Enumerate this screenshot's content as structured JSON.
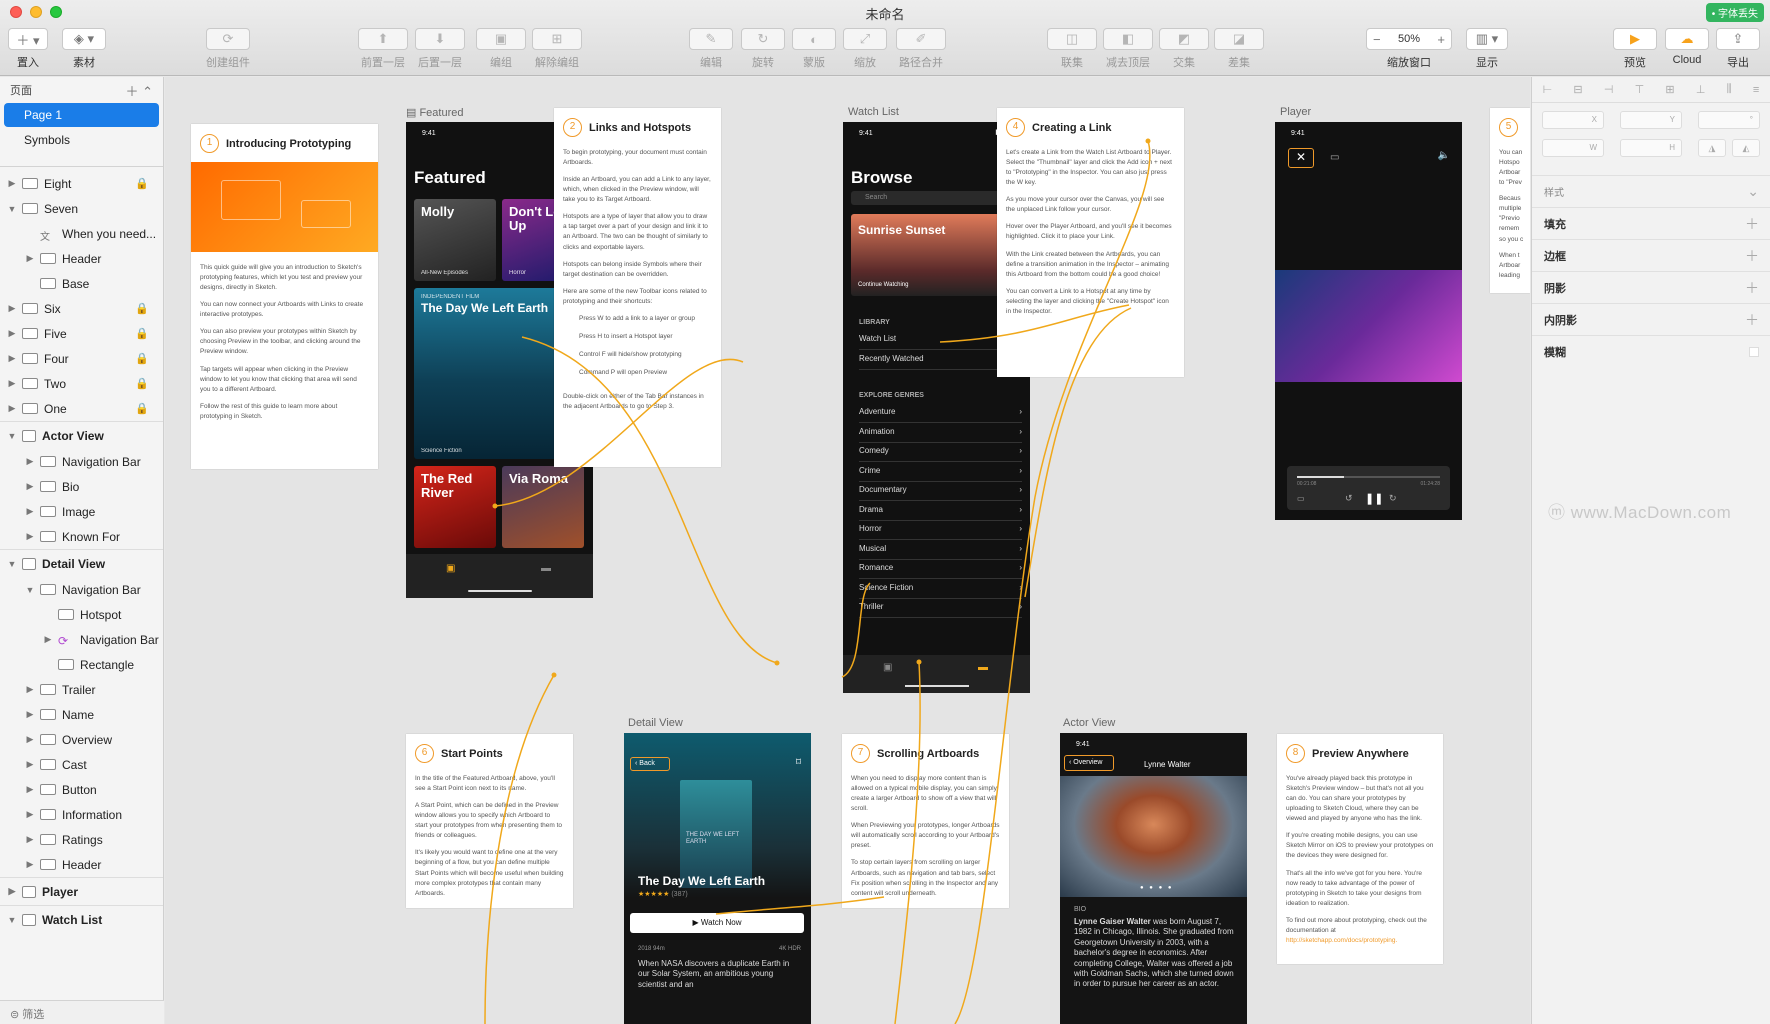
{
  "window": {
    "title": "未命名",
    "font_missing": "• 字体丢失"
  },
  "toolbar": {
    "insert": "置入",
    "assets": "素材",
    "create_symbol": "创建组件",
    "forward": "前置一层",
    "backward": "后置一层",
    "group": "编组",
    "ungroup": "解除编组",
    "edit": "编辑",
    "rotate": "旋转",
    "mask": "蒙版",
    "scale": "缩放",
    "flatten": "路径合并",
    "union": "联集",
    "subtract": "减去顶层",
    "intersect": "交集",
    "difference": "差集",
    "zoom_value": "50%",
    "zoom_label": "缩放窗口",
    "view": "显示",
    "preview": "预览",
    "cloud": "Cloud",
    "export": "导出"
  },
  "sidebar": {
    "pages_header": "页面",
    "pages": [
      "Page 1",
      "Symbols"
    ],
    "layers": [
      {
        "label": "Eight",
        "indent": 0,
        "arrow": "▶",
        "lock": true
      },
      {
        "label": "Seven",
        "indent": 0,
        "arrow": "▼",
        "lock": false
      },
      {
        "label": "When you need...",
        "indent": 1,
        "arrow": "",
        "lock": false,
        "text": true
      },
      {
        "label": "Header",
        "indent": 1,
        "arrow": "▶",
        "lock": false
      },
      {
        "label": "Base",
        "indent": 1,
        "arrow": "",
        "lock": false
      },
      {
        "label": "Six",
        "indent": 0,
        "arrow": "▶",
        "lock": true
      },
      {
        "label": "Five",
        "indent": 0,
        "arrow": "▶",
        "lock": true
      },
      {
        "label": "Four",
        "indent": 0,
        "arrow": "▶",
        "lock": true
      },
      {
        "label": "Two",
        "indent": 0,
        "arrow": "▶",
        "lock": true
      },
      {
        "label": "One",
        "indent": 0,
        "arrow": "▶",
        "lock": true
      },
      {
        "label": "Actor View",
        "indent": 0,
        "arrow": "▼",
        "artboard": true
      },
      {
        "label": "Navigation Bar",
        "indent": 1,
        "arrow": "▶"
      },
      {
        "label": "Bio",
        "indent": 1,
        "arrow": "▶"
      },
      {
        "label": "Image",
        "indent": 1,
        "arrow": "▶"
      },
      {
        "label": "Known For",
        "indent": 1,
        "arrow": "▶"
      },
      {
        "label": "Detail View",
        "indent": 0,
        "arrow": "▼",
        "artboard": true
      },
      {
        "label": "Navigation Bar",
        "indent": 1,
        "arrow": "▼"
      },
      {
        "label": "Hotspot",
        "indent": 2,
        "arrow": ""
      },
      {
        "label": "Navigation Bar",
        "indent": 2,
        "arrow": "▶",
        "symbol": true
      },
      {
        "label": "Rectangle",
        "indent": 2,
        "arrow": ""
      },
      {
        "label": "Trailer",
        "indent": 1,
        "arrow": "▶"
      },
      {
        "label": "Name",
        "indent": 1,
        "arrow": "▶"
      },
      {
        "label": "Overview",
        "indent": 1,
        "arrow": "▶"
      },
      {
        "label": "Cast",
        "indent": 1,
        "arrow": "▶"
      },
      {
        "label": "Button",
        "indent": 1,
        "arrow": "▶"
      },
      {
        "label": "Information",
        "indent": 1,
        "arrow": "▶"
      },
      {
        "label": "Ratings",
        "indent": 1,
        "arrow": "▶"
      },
      {
        "label": "Header",
        "indent": 1,
        "arrow": "▶"
      },
      {
        "label": "Player",
        "indent": 0,
        "arrow": "▶",
        "artboard": true
      },
      {
        "label": "Watch List",
        "indent": 0,
        "arrow": "▼",
        "artboard": true
      }
    ],
    "filter": "筛选"
  },
  "canvas": {
    "artboard_labels": {
      "featured": "Featured",
      "watchlist": "Watch List",
      "player": "Player",
      "detail": "Detail View",
      "actor": "Actor View"
    },
    "card1": {
      "num": "1",
      "title": "Introducing Prototyping",
      "paras": [
        "This quick guide will give you an introduction to Sketch's prototyping features, which let you test and preview your designs, directly in Sketch.",
        "You can now connect your Artboards with Links to create interactive prototypes.",
        "You can also preview your prototypes within Sketch by choosing Preview in the toolbar, and clicking around the Preview window.",
        "Tap targets will appear when clicking in the Preview window to let you know that clicking that area will send you to a different Artboard.",
        "Follow the rest of this guide to learn more about prototyping in Sketch."
      ]
    },
    "card2": {
      "num": "2",
      "title": "Links and Hotspots",
      "paras": [
        "To begin prototyping, your document must contain Artboards.",
        "Inside an Artboard, you can add a Link to any layer, which, when clicked in the Preview window, will take you to its Target Artboard.",
        "Hotspots are a type of layer that allow you to draw a tap target over a part of your design and link it to an Artboard. The two can be thought of similarly to clicks and exportable layers.",
        "Hotspots can belong inside Symbols where their target destination can be overridden.",
        "Here are some of the new Toolbar icons related to prototyping and their shortcuts:",
        "Press W to add a link to a layer or group",
        "Press H to insert a Hotspot layer",
        "Control F will hide/show prototyping",
        "Command P will open Preview",
        "Double-click on either of the Tab Bar instances in the adjacent Artboards to go to Step 3."
      ]
    },
    "card4": {
      "num": "4",
      "title": "Creating a Link",
      "paras": [
        "Let's create a Link from the Watch List Artboard to Player. Select the \"Thumbnail\" layer and click the Add icon + next to \"Prototyping\" in the Inspector. You can also just press the W key.",
        "As you move your cursor over the Canvas, you will see the unplaced Link follow your cursor.",
        "Hover over the Player Artboard, and you'll see it becomes highlighted. Click it to place your Link.",
        "With the Link created between the Artboards, you can define a transition animation in the Inspector – animating this Artboard from the bottom could be a good choice!",
        "You can convert a Link to a Hotspot at any time by selecting the layer and clicking the \"Create Hotspot\" icon in the Inspector."
      ]
    },
    "card5": {
      "num": "5",
      "frag": [
        "You can",
        "Hotspo",
        "Artboar",
        "to \"Prev",
        "Becaus",
        "multiple",
        "\"Previo",
        "remem",
        "so you c",
        "When t",
        "Artboar",
        "leading"
      ]
    },
    "card6": {
      "num": "6",
      "title": "Start Points",
      "paras": [
        "In the title of the Featured Artboard, above, you'll see a Start Point icon next to its name.",
        "A Start Point, which can be defined in the Preview window allows you to specify which Artboard to start your prototypes from when presenting them to friends or colleagues.",
        "It's likely you would want to define one at the very beginning of a flow, but you can define multiple Start Points which will become useful when building more complex prototypes that contain many Artboards."
      ]
    },
    "card7": {
      "num": "7",
      "title": "Scrolling Artboards",
      "paras": [
        "When you need to display more content than is allowed on a typical mobile display, you can simply create a larger Artboard to show off a view that will scroll.",
        "When Previewing your prototypes, longer Artboards will automatically scroll according to your Artboard's preset.",
        "To stop certain layers from scrolling on larger Artboards, such as navigation and tab bars, select Fix position when scrolling in the Inspector and any content will scroll underneath."
      ]
    },
    "card8": {
      "num": "8",
      "title": "Preview Anywhere",
      "paras": [
        "You've already played back this prototype in Sketch's Preview window – but that's not all you can do. You can share your prototypes by uploading to Sketch Cloud, where they can be viewed and played by anyone who has the link.",
        "If you're creating mobile designs, you can use Sketch Mirror on iOS to preview your prototypes on the devices they were designed for.",
        "That's all the info we've got for you here. You're now ready to take advantage of the power of prototyping in Sketch to take your designs from ideation to realization.",
        "To find out more about prototyping, check out the documentation at",
        "http://sketchapp.com/docs/prototyping."
      ]
    },
    "featured": {
      "time": "9:41",
      "heading": "Featured",
      "tiles": [
        {
          "title": "Molly",
          "sub": "All-New Episodes"
        },
        {
          "title": "Don't Look Up",
          "sub": "Horror"
        },
        {
          "title": "The Day We Left Earth",
          "sub": "Science Fiction",
          "kicker": "INDEPENDENT FILM"
        },
        {
          "title": "The Red River",
          "sub": ""
        },
        {
          "title": "Via Roma",
          "sub": ""
        }
      ]
    },
    "browse": {
      "time": "9:41",
      "heading": "Browse",
      "search": "Search",
      "hero": "Sunrise Sunset",
      "hero_sub": "Continue Watching",
      "library": "LIBRARY",
      "library_rows": [
        "Watch List",
        "Recently Watched"
      ],
      "genres": "EXPLORE GENRES",
      "genre_rows": [
        "Adventure",
        "Animation",
        "Comedy",
        "Crime",
        "Documentary",
        "Drama",
        "Horror",
        "Musical",
        "Romance",
        "Science Fiction",
        "Thriller"
      ]
    },
    "player": {
      "time": "9:41",
      "elapsed": "00:21:08",
      "remaining": "01:24:28"
    },
    "detail": {
      "back": "Back",
      "title": "The Day We Left Earth",
      "stars": "★★★★★",
      "rating_count": "(387)",
      "watch": "Watch Now",
      "meta": "2018   94m",
      "meta_badges": "4K  HDR",
      "poster": "THE DAY WE LEFT EARTH",
      "synopsis": "When NASA discovers a duplicate Earth in our Solar System, an ambitious young scientist and an"
    },
    "actor": {
      "time": "9:41",
      "back": "Overview",
      "name": "Lynne Walter",
      "bio_label": "BIO",
      "bio_name": "Lynne Gaiser Walter",
      "bio": "was born August 7, 1982 in Chicago, Illinois. She graduated from Georgetown University in 2003, with a bachelor's degree in economics. After completing College, Walter was offered a job with Goldman Sachs, which she turned down in order to pursue her career as an actor."
    }
  },
  "inspector": {
    "x": "X",
    "y": "Y",
    "r": "°",
    "w": "W",
    "h": "H",
    "sections": [
      "样式",
      "填充",
      "边框",
      "阴影",
      "内阴影",
      "模糊"
    ]
  },
  "watermark": "www.MacDown.com",
  "colors": {
    "accent": "#f09a2a",
    "selection": "#1a7de8",
    "cloud": "#f7a21b",
    "preview": "#f7a21b"
  }
}
